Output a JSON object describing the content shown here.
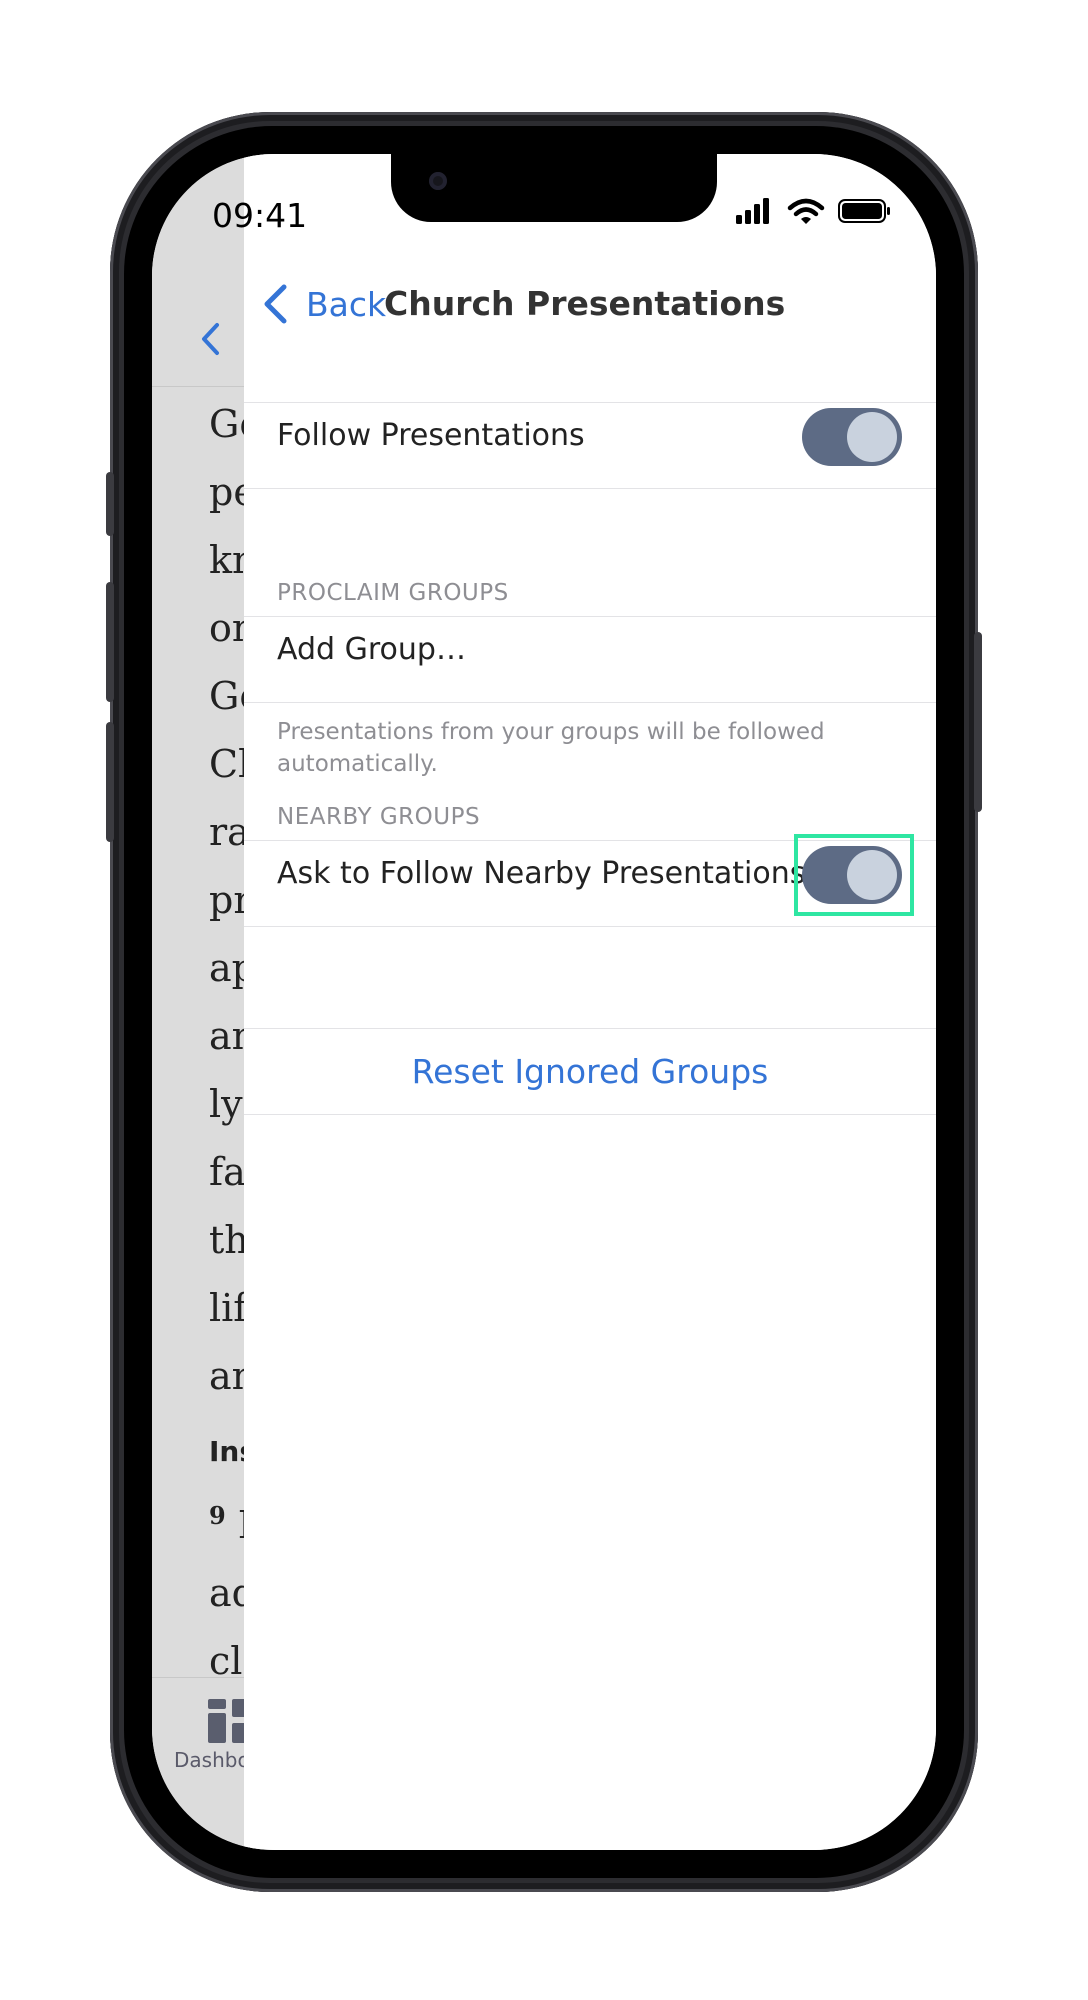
{
  "status_bar": {
    "time": "09:41"
  },
  "background": {
    "text_lines": [
      "Go",
      "pe",
      "kn",
      "on",
      "Go",
      "Cl",
      "ra",
      "pr",
      "ap",
      "an",
      "ly",
      "fa",
      "th",
      "lif",
      "an"
    ],
    "heading": "Ins",
    "verse_number": "9",
    "verse_lines": [
      "I",
      "ad",
      "cl"
    ],
    "tab_label": "Dashbo"
  },
  "nav": {
    "back_label": "Back",
    "title": "Church Presentations"
  },
  "follow_presentations": {
    "label": "Follow Presentations",
    "on": true
  },
  "proclaim_groups": {
    "header": "PROCLAIM GROUPS",
    "add_group_label": "Add Group…",
    "footer": "Presentations from your groups will be followed automatically."
  },
  "nearby_groups": {
    "header": "NEARBY GROUPS",
    "ask_follow_label": "Ask to Follow Nearby Presentations",
    "on": true
  },
  "reset_label": "Reset Ignored Groups",
  "colors": {
    "accent": "#3474d6",
    "toggle_on": "#5d6b85",
    "highlight": "#2ee6a2"
  }
}
